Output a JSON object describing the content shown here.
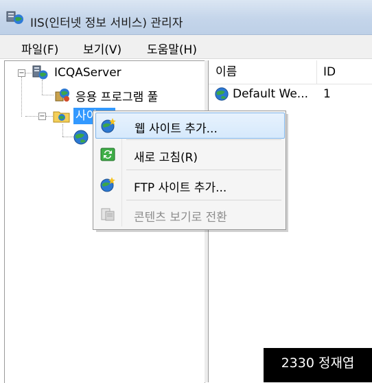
{
  "window": {
    "title": "IIS(인터넷 정보 서비스) 관리자"
  },
  "menu": {
    "file": "파일(F)",
    "view": "보기(V)",
    "help": "도움말(H)"
  },
  "tree": {
    "server": {
      "label": "ICQAServer",
      "icon": "server-icon"
    },
    "app_pools": {
      "label": "응용 프로그램 풀",
      "icon": "app-pool-icon"
    },
    "sites": {
      "label": "사이트",
      "icon": "folder-globe-icon",
      "selected": true
    }
  },
  "list": {
    "columns": {
      "name": "이름",
      "id": "ID"
    },
    "rows": [
      {
        "name": "Default We...",
        "id": "1",
        "icon": "globe-icon"
      }
    ]
  },
  "context_menu": {
    "items": [
      {
        "label": "웹 사이트 추가...",
        "icon": "globe-add-icon",
        "highlighted": true,
        "enabled": true
      },
      {
        "label": "새로 고침(R)",
        "icon": "refresh-icon",
        "enabled": true
      },
      {
        "label": "FTP 사이트 추가...",
        "icon": "ftp-add-icon",
        "enabled": true
      },
      {
        "label": "콘텐츠 보기로 전환",
        "icon": "content-view-icon",
        "enabled": false
      }
    ]
  },
  "watermark": {
    "text": "2330 정재엽"
  }
}
